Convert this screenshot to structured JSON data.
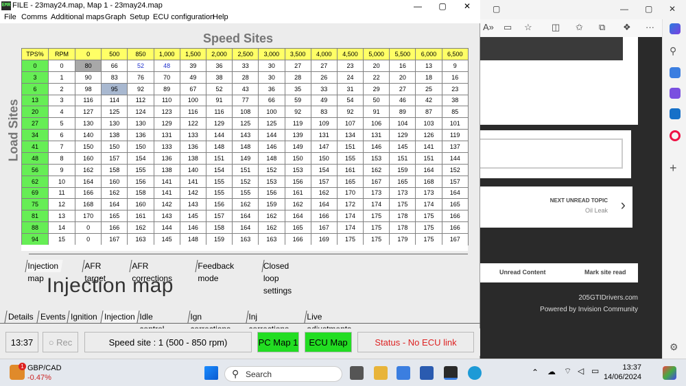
{
  "window": {
    "icon_text": "EMR",
    "title": "FILE - 23may24.map,  Map 1 - 23may24.map",
    "controls": {
      "minimize": "—",
      "maximize": "▢",
      "close": "✕"
    }
  },
  "menu": [
    "File",
    "Comms",
    "Additional maps",
    "Graph",
    "Setup",
    "ECU configuration",
    "Help"
  ],
  "grid": {
    "title": "Speed Sites",
    "side_label": "Load Sites",
    "corner_tps": "TPS%",
    "corner_rpm": "RPM",
    "rpm_columns": [
      "0",
      "500",
      "850",
      "1,000",
      "1,500",
      "2,000",
      "2,500",
      "3,000",
      "3,500",
      "4,000",
      "4,500",
      "5,000",
      "5,500",
      "6,000",
      "6,500"
    ],
    "rows": [
      {
        "tps": "0",
        "site": "0",
        "cells": [
          "80",
          "66",
          "52",
          "48",
          "39",
          "36",
          "33",
          "30",
          "27",
          "27",
          "23",
          "20",
          "16",
          "13",
          "9"
        ]
      },
      {
        "tps": "3",
        "site": "1",
        "cells": [
          "90",
          "83",
          "76",
          "70",
          "49",
          "38",
          "28",
          "30",
          "28",
          "26",
          "24",
          "22",
          "20",
          "18",
          "16"
        ]
      },
      {
        "tps": "6",
        "site": "2",
        "cells": [
          "98",
          "95",
          "92",
          "89",
          "67",
          "52",
          "43",
          "36",
          "35",
          "33",
          "31",
          "29",
          "27",
          "25",
          "23"
        ]
      },
      {
        "tps": "13",
        "site": "3",
        "cells": [
          "116",
          "114",
          "112",
          "110",
          "100",
          "91",
          "77",
          "66",
          "59",
          "49",
          "54",
          "50",
          "46",
          "42",
          "38"
        ]
      },
      {
        "tps": "20",
        "site": "4",
        "cells": [
          "127",
          "125",
          "124",
          "123",
          "116",
          "116",
          "108",
          "100",
          "92",
          "83",
          "92",
          "91",
          "89",
          "87",
          "85"
        ]
      },
      {
        "tps": "27",
        "site": "5",
        "cells": [
          "130",
          "130",
          "130",
          "129",
          "122",
          "129",
          "125",
          "125",
          "119",
          "109",
          "107",
          "106",
          "104",
          "103",
          "101"
        ]
      },
      {
        "tps": "34",
        "site": "6",
        "cells": [
          "140",
          "138",
          "136",
          "131",
          "133",
          "144",
          "143",
          "144",
          "139",
          "131",
          "134",
          "131",
          "129",
          "126",
          "119"
        ]
      },
      {
        "tps": "41",
        "site": "7",
        "cells": [
          "150",
          "150",
          "150",
          "133",
          "136",
          "148",
          "148",
          "146",
          "149",
          "147",
          "151",
          "146",
          "145",
          "141",
          "137"
        ]
      },
      {
        "tps": "48",
        "site": "8",
        "cells": [
          "160",
          "157",
          "154",
          "136",
          "138",
          "151",
          "149",
          "148",
          "150",
          "150",
          "155",
          "153",
          "151",
          "151",
          "144"
        ]
      },
      {
        "tps": "56",
        "site": "9",
        "cells": [
          "162",
          "158",
          "155",
          "138",
          "140",
          "154",
          "151",
          "152",
          "153",
          "154",
          "161",
          "162",
          "159",
          "164",
          "152"
        ]
      },
      {
        "tps": "62",
        "site": "10",
        "cells": [
          "164",
          "160",
          "156",
          "141",
          "141",
          "155",
          "152",
          "153",
          "156",
          "157",
          "165",
          "167",
          "165",
          "168",
          "157"
        ]
      },
      {
        "tps": "69",
        "site": "11",
        "cells": [
          "166",
          "162",
          "158",
          "141",
          "142",
          "155",
          "155",
          "156",
          "161",
          "162",
          "170",
          "173",
          "173",
          "173",
          "164"
        ]
      },
      {
        "tps": "75",
        "site": "12",
        "cells": [
          "168",
          "164",
          "160",
          "142",
          "143",
          "156",
          "162",
          "159",
          "162",
          "164",
          "172",
          "174",
          "175",
          "174",
          "165"
        ]
      },
      {
        "tps": "81",
        "site": "13",
        "cells": [
          "170",
          "165",
          "161",
          "143",
          "145",
          "157",
          "164",
          "162",
          "164",
          "166",
          "174",
          "175",
          "178",
          "175",
          "166"
        ]
      },
      {
        "tps": "88",
        "site": "14",
        "cells": [
          "0",
          "166",
          "162",
          "144",
          "146",
          "158",
          "164",
          "162",
          "165",
          "167",
          "174",
          "175",
          "178",
          "175",
          "166"
        ]
      },
      {
        "tps": "94",
        "site": "15",
        "cells": [
          "0",
          "167",
          "163",
          "145",
          "148",
          "159",
          "163",
          "163",
          "166",
          "169",
          "175",
          "175",
          "179",
          "175",
          "167"
        ]
      }
    ],
    "highlight": {
      "grey": [
        0,
        0
      ],
      "selected": [
        2,
        1
      ],
      "blue": [
        [
          0,
          2
        ],
        [
          0,
          3
        ]
      ]
    }
  },
  "map_tabs": [
    "Injection map",
    "AFR target",
    "AFR corrections",
    "Feedback mode",
    "Closed loop settings"
  ],
  "active_map_tab": "Injection map",
  "section_title": "Injection map",
  "bottom_tabs": [
    "Details",
    "Events",
    "Ignition",
    "Injection",
    "Idle control",
    "Ign corrections",
    "Inj corrections",
    "Live adjustments"
  ],
  "active_bottom_tab": "Injection",
  "status": {
    "time": "13:37",
    "rec": "Rec",
    "speed_site": "Speed site : 1 (500 - 850 rpm)",
    "pc_map": "PC Map 1",
    "ecu_map": "ECU Map 1",
    "link": "Status - No ECU link"
  },
  "browser": {
    "next_label": "NEXT UNREAD TOPIC",
    "next_topic": "Oil Leak",
    "unread": "Unread Content",
    "mark_read": "Mark site read",
    "footer1": "205GTIDrivers.com",
    "footer2": "Powered by Invision Community"
  },
  "taskbar": {
    "ticker": "GBP/CAD",
    "change": "-0.47%",
    "badge": "1",
    "search": "Search",
    "time": "13:37",
    "date": "14/06/2024"
  },
  "colors": {
    "header_yellow": "#ffff66",
    "header_green": "#66ee55",
    "pc_map": "#22dd22",
    "link_red": "#dd2222"
  }
}
